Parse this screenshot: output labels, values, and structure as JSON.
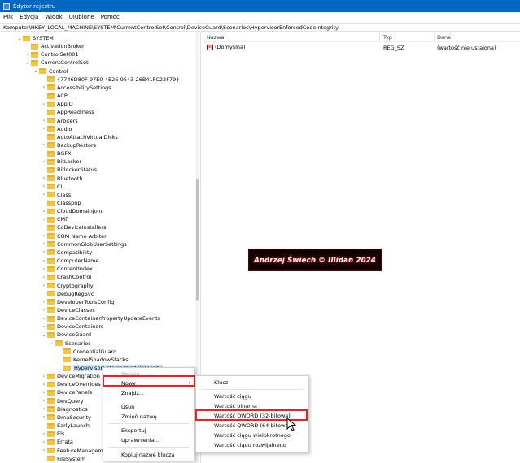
{
  "window": {
    "title": "Edytor rejestru"
  },
  "menubar": [
    "Plik",
    "Edycja",
    "Widok",
    "Ulubione",
    "Pomoc"
  ],
  "address": "Komputer\\HKEY_LOCAL_MACHINE\\SYSTEM\\CurrentControlSet\\Control\\DeviceGuard\\Scenarios\\HypervisorEnforcedCodeIntegrity",
  "tree": [
    {
      "label": "SYSTEM",
      "chev": "⌄"
    },
    {
      "label": "ActivationBroker",
      "chev": ""
    },
    {
      "label": "ControlSet001",
      "chev": "›"
    },
    {
      "label": "CurrentControlSet",
      "chev": "⌄"
    },
    {
      "label": "Control",
      "chev": "⌄"
    },
    {
      "label": "{7746D80F-97E0-4E26-9543-26B41FC22F79}",
      "chev": ""
    },
    {
      "label": "AccessibilitySettings",
      "chev": "›"
    },
    {
      "label": "ACPI",
      "chev": ""
    },
    {
      "label": "AppID",
      "chev": "›"
    },
    {
      "label": "AppReadiness",
      "chev": ""
    },
    {
      "label": "Arbiters",
      "chev": "›"
    },
    {
      "label": "Audio",
      "chev": "›"
    },
    {
      "label": "AutoAttachVirtualDisks",
      "chev": ""
    },
    {
      "label": "BackupRestore",
      "chev": "›"
    },
    {
      "label": "BGFX",
      "chev": ""
    },
    {
      "label": "BitLocker",
      "chev": "›"
    },
    {
      "label": "BitlockerStatus",
      "chev": ""
    },
    {
      "label": "Bluetooth",
      "chev": "›"
    },
    {
      "label": "CI",
      "chev": "›"
    },
    {
      "label": "Class",
      "chev": "›"
    },
    {
      "label": "Classpnp",
      "chev": ""
    },
    {
      "label": "CloudDomainJoin",
      "chev": "›"
    },
    {
      "label": "CMF",
      "chev": "›"
    },
    {
      "label": "CoDeviceInstallers",
      "chev": ""
    },
    {
      "label": "COM Name Arbiter",
      "chev": "›"
    },
    {
      "label": "CommonGlobUserSettings",
      "chev": "›"
    },
    {
      "label": "Compatibility",
      "chev": "›"
    },
    {
      "label": "ComputerName",
      "chev": "›"
    },
    {
      "label": "ContentIndex",
      "chev": "›"
    },
    {
      "label": "CrashControl",
      "chev": "›"
    },
    {
      "label": "Cryptography",
      "chev": "›"
    },
    {
      "label": "DebugRegSvc",
      "chev": ""
    },
    {
      "label": "DeveloperToolsConfig",
      "chev": "›"
    },
    {
      "label": "DeviceClasses",
      "chev": "›"
    },
    {
      "label": "DeviceContainerPropertyUpdateEvents",
      "chev": "›"
    },
    {
      "label": "DeviceContainers",
      "chev": "›"
    },
    {
      "label": "DeviceGuard",
      "chev": "⌄"
    },
    {
      "label": "Scenarios",
      "chev": "⌄"
    },
    {
      "label": "CredentialGuard",
      "chev": ""
    },
    {
      "label": "KernelShadowStacks",
      "chev": ""
    },
    {
      "label": "HypervisorEnforcedCodeIntegrity",
      "chev": ""
    },
    {
      "label": "DeviceMigration",
      "chev": "›"
    },
    {
      "label": "DeviceOverrides",
      "chev": "›"
    },
    {
      "label": "DevicePanels",
      "chev": "›"
    },
    {
      "label": "DevQuery",
      "chev": "›"
    },
    {
      "label": "Diagnostics",
      "chev": "›"
    },
    {
      "label": "DmaSecurity",
      "chev": "›"
    },
    {
      "label": "EarlyLaunch",
      "chev": ""
    },
    {
      "label": "Els",
      "chev": "›"
    },
    {
      "label": "Errata",
      "chev": "›"
    },
    {
      "label": "FeatureManagement",
      "chev": "›"
    },
    {
      "label": "FileSystem",
      "chev": ""
    }
  ],
  "list": {
    "headers": {
      "name": "Nazwa",
      "type": "Typ",
      "data": "Dane"
    },
    "rows": [
      {
        "icon": "ab",
        "name": "(Domyślna)",
        "type": "REG_SZ",
        "data": "(wartość nie ustalona)"
      }
    ]
  },
  "watermark": "Andrzej Świech © Illidan 2024",
  "context_menu": {
    "header": "Rozwiń",
    "items": [
      "Nowy",
      "Znajdź...",
      "Usuń",
      "Zmień nazwę",
      "Eksportuj",
      "Uprawnienia...",
      "Kopiuj nazwę klucza"
    ]
  },
  "submenu": {
    "items": [
      "Klucz",
      "Wartość ciągu",
      "Wartość binarna",
      "Wartość DWORD (32-bitowa)",
      "Wartość QWORD (64-bitowa)",
      "Wartość ciągu wielokrotnego",
      "Wartość ciągu rozwijalnego"
    ]
  },
  "colors": {
    "titlebar": "#0067c0",
    "folder": "#f5c542",
    "highlight": "#e3242b",
    "selection": "#cce8ff"
  }
}
